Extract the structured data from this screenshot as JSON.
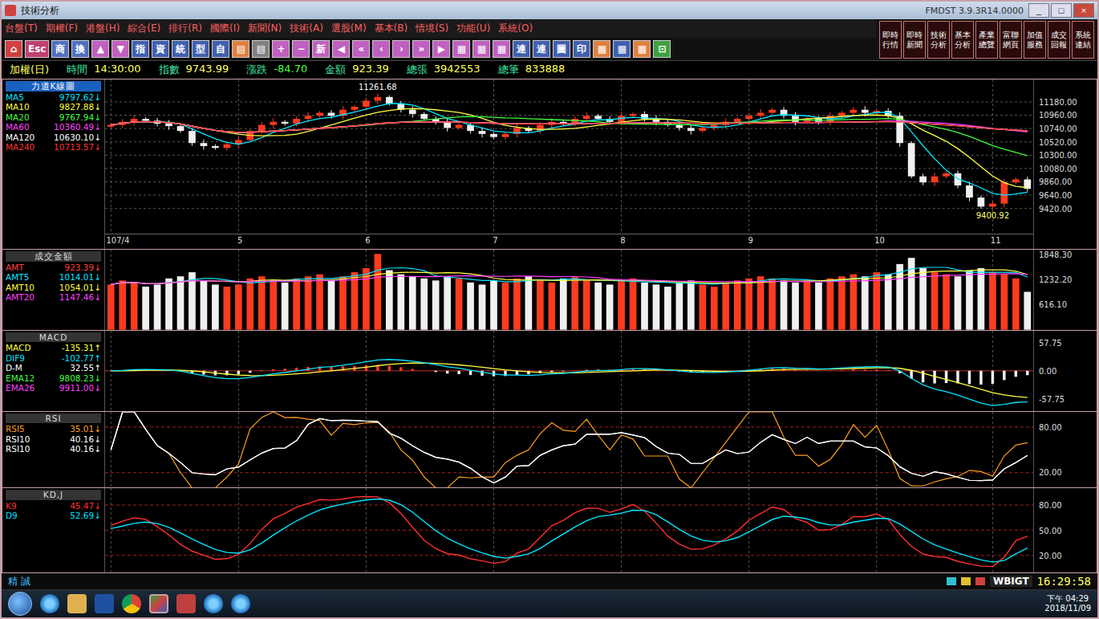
{
  "window": {
    "title": "技術分析",
    "version": "FMDST 3.9.3R14.0000",
    "controls": [
      "_",
      "□",
      "×"
    ]
  },
  "menu": [
    "台盤(T)",
    "期權(F)",
    "港盤(H)",
    "綜合(E)",
    "排行(R)",
    "國際(I)",
    "新聞(N)",
    "技術(A)",
    "選股(M)",
    "基本(B)",
    "情境(S)",
    "功能(U)",
    "系統(O)"
  ],
  "quick_buttons": [
    "即時行情",
    "即時新聞",
    "技術分析",
    "基本分析",
    "產業總覽",
    "富聯網頁",
    "加值服務",
    "成交回報",
    "系統連結"
  ],
  "toolbar": [
    {
      "label": "⌂",
      "color": "#d04040"
    },
    {
      "label": "Esc",
      "color": "#c04070"
    },
    {
      "label": "商",
      "color": "#5070c0"
    },
    {
      "label": "換",
      "color": "#5070c0"
    },
    {
      "label": "▲",
      "color": "#c060c0"
    },
    {
      "label": "▼",
      "color": "#c060c0"
    },
    {
      "label": "指",
      "color": "#4060b0"
    },
    {
      "label": "資",
      "color": "#4060b0"
    },
    {
      "label": "統",
      "color": "#4060b0"
    },
    {
      "label": "型",
      "color": "#4060b0"
    },
    {
      "label": "自",
      "color": "#4060b0"
    },
    {
      "label": "▤",
      "color": "#e08040"
    },
    {
      "label": "▤",
      "color": "#808080"
    },
    {
      "label": "+",
      "color": "#c060c0"
    },
    {
      "label": "−",
      "color": "#c060c0"
    },
    {
      "label": "新",
      "color": "#c060c0"
    },
    {
      "label": "◀",
      "color": "#c060c0"
    },
    {
      "label": "«",
      "color": "#c060c0"
    },
    {
      "label": "‹",
      "color": "#c060c0"
    },
    {
      "label": "›",
      "color": "#c060c0"
    },
    {
      "label": "»",
      "color": "#c060c0"
    },
    {
      "label": "▶",
      "color": "#c060c0"
    },
    {
      "label": "▦",
      "color": "#c060c0"
    },
    {
      "label": "▦",
      "color": "#c060c0"
    },
    {
      "label": "▦",
      "color": "#c060c0"
    },
    {
      "label": "連",
      "color": "#4060b0"
    },
    {
      "label": "連",
      "color": "#4060b0"
    },
    {
      "label": "圖",
      "color": "#4060b0"
    },
    {
      "label": "印",
      "color": "#4060b0"
    },
    {
      "label": "▦",
      "color": "#e08040"
    },
    {
      "label": "▦",
      "color": "#4060b0"
    },
    {
      "label": "▦",
      "color": "#e08040"
    },
    {
      "label": "⊡",
      "color": "#40a040"
    }
  ],
  "info_bar": {
    "symbol": "加權(日)",
    "fields": [
      {
        "label": "時間",
        "value": "14:30:00"
      },
      {
        "label": "指數",
        "value": "9743.99"
      },
      {
        "label": "漲跌",
        "value": "-84.70"
      },
      {
        "label": "金額",
        "value": "923.39"
      },
      {
        "label": "總張",
        "value": "3942553"
      },
      {
        "label": "總筆",
        "value": "833888"
      }
    ]
  },
  "price_panel": {
    "title": "力道K線圖",
    "legend": [
      {
        "name": "MA5",
        "value": "9797.62↓",
        "color": "#00e5ff",
        "period": 5
      },
      {
        "name": "MA10",
        "value": "9827.88↓",
        "color": "#ffff40",
        "period": 10
      },
      {
        "name": "MA20",
        "value": "9767.94↓",
        "color": "#40ff40",
        "period": 20
      },
      {
        "name": "MA60",
        "value": "10360.49↓",
        "color": "#ff40ff",
        "period": 60
      },
      {
        "name": "MA120",
        "value": "10630.10↓",
        "color": "#ffffff",
        "period": 120
      },
      {
        "name": "MA240",
        "value": "10713.57↓",
        "color": "#ff3030",
        "period": 240
      }
    ],
    "high_label": "11261.68",
    "low_label": "9400.92",
    "y_ticks": [
      "11180.00",
      "10960.00",
      "10740.00",
      "10520.00",
      "10300.00",
      "10080.00",
      "9860.00",
      "9640.00",
      "9420.00"
    ],
    "y_range": [
      9000,
      11550
    ],
    "x_labels": [
      {
        "label": "107/4",
        "index": 0
      },
      {
        "label": "5",
        "index": 11
      },
      {
        "label": "6",
        "index": 22
      },
      {
        "label": "7",
        "index": 33
      },
      {
        "label": "8",
        "index": 44
      },
      {
        "label": "9",
        "index": 55
      },
      {
        "label": "10",
        "index": 66
      },
      {
        "label": "11",
        "index": 76
      }
    ],
    "closes": [
      10800,
      10850,
      10900,
      10870,
      10820,
      10780,
      10700,
      10500,
      10450,
      10420,
      10480,
      10550,
      10700,
      10800,
      10850,
      10820,
      10900,
      10950,
      11000,
      10950,
      11050,
      11100,
      11200,
      11261,
      11150,
      11050,
      10980,
      10900,
      10850,
      10750,
      10800,
      10700,
      10650,
      10600,
      10650,
      10750,
      10700,
      10800,
      10850,
      10820,
      10900,
      10950,
      10900,
      10850,
      10950,
      10980,
      10900,
      10850,
      10800,
      10750,
      10700,
      10750,
      10800,
      10850,
      10900,
      10950,
      11000,
      11050,
      10950,
      10850,
      10900,
      10850,
      10950,
      11000,
      11050,
      11000,
      11031,
      10950,
      10500,
      9950,
      9850,
      9950,
      10000,
      9800,
      9600,
      9450,
      9500,
      9850,
      9900,
      9743.99
    ]
  },
  "volume_panel": {
    "title": "成交金額",
    "legend": [
      {
        "name": "AMT",
        "value": "923.39↓",
        "color": "#ff4040",
        "period": 1
      },
      {
        "name": "AMT5",
        "value": "1014.01↓",
        "color": "#00e5ff",
        "period": 5
      },
      {
        "name": "AMT10",
        "value": "1054.01↓",
        "color": "#ffff40",
        "period": 10
      },
      {
        "name": "AMT20",
        "value": "1147.46↓",
        "color": "#ff40ff",
        "period": 20
      }
    ],
    "y_ticks": [
      "1848.30",
      "1232.20",
      "616.10"
    ],
    "y_max": 1950,
    "values": [
      1100,
      1200,
      1150,
      1050,
      1100,
      1250,
      1300,
      1400,
      1200,
      1100,
      1050,
      1100,
      1250,
      1300,
      1200,
      1150,
      1250,
      1300,
      1350,
      1200,
      1300,
      1400,
      1500,
      1848,
      1450,
      1350,
      1300,
      1250,
      1200,
      1300,
      1250,
      1150,
      1100,
      1200,
      1150,
      1250,
      1300,
      1200,
      1150,
      1250,
      1300,
      1200,
      1150,
      1100,
      1200,
      1250,
      1150,
      1100,
      1050,
      1150,
      1200,
      1100,
      1050,
      1150,
      1200,
      1250,
      1300,
      1250,
      1200,
      1150,
      1200,
      1150,
      1250,
      1300,
      1350,
      1300,
      1400,
      1350,
      1600,
      1750,
      1500,
      1400,
      1350,
      1300,
      1450,
      1500,
      1400,
      1350,
      1250,
      923.39
    ]
  },
  "macd_panel": {
    "title": "MACD",
    "legend": [
      {
        "name": "MACD",
        "value": "-135.31↑",
        "color": "#ffff40"
      },
      {
        "name": "DIF9",
        "value": "-102.77↑",
        "color": "#00e5ff"
      },
      {
        "name": "D-M",
        "value": "32.55↑",
        "color": "#ffffff"
      },
      {
        "name": "EMA12",
        "value": "9808.23↓",
        "color": "#40ff40"
      },
      {
        "name": "EMA26",
        "value": "9911.00↓",
        "color": "#ff40ff"
      }
    ],
    "y_ticks": [
      "57.75",
      "0.00",
      "-57.75"
    ]
  },
  "rsi_panel": {
    "title": "RSI",
    "legend": [
      {
        "name": "RSI5",
        "value": "35.01↓",
        "color": "#ffa020",
        "period": 5
      },
      {
        "name": "RSI10",
        "value": "40.16↓",
        "color": "#ffffff",
        "period": 10
      },
      {
        "name": "RSI10",
        "value": "40.16↓",
        "color": "#ffffff",
        "period": 10
      }
    ],
    "y_ticks": [
      "80.00",
      "20.00"
    ]
  },
  "kd_panel": {
    "title": "KD,J",
    "legend": [
      {
        "name": "K9",
        "value": "45.47↓",
        "color": "#ff3030"
      },
      {
        "name": "D9",
        "value": "52.69↓",
        "color": "#00e5ff"
      }
    ],
    "y_ticks": [
      "80.00",
      "50.00",
      "20.00"
    ]
  },
  "status_bar": {
    "brand": "精 誠",
    "code": "WBIGT",
    "time": "16:29:58"
  },
  "taskbar": {
    "clock_time": "下午 04:29",
    "clock_date": "2018/11/09"
  }
}
